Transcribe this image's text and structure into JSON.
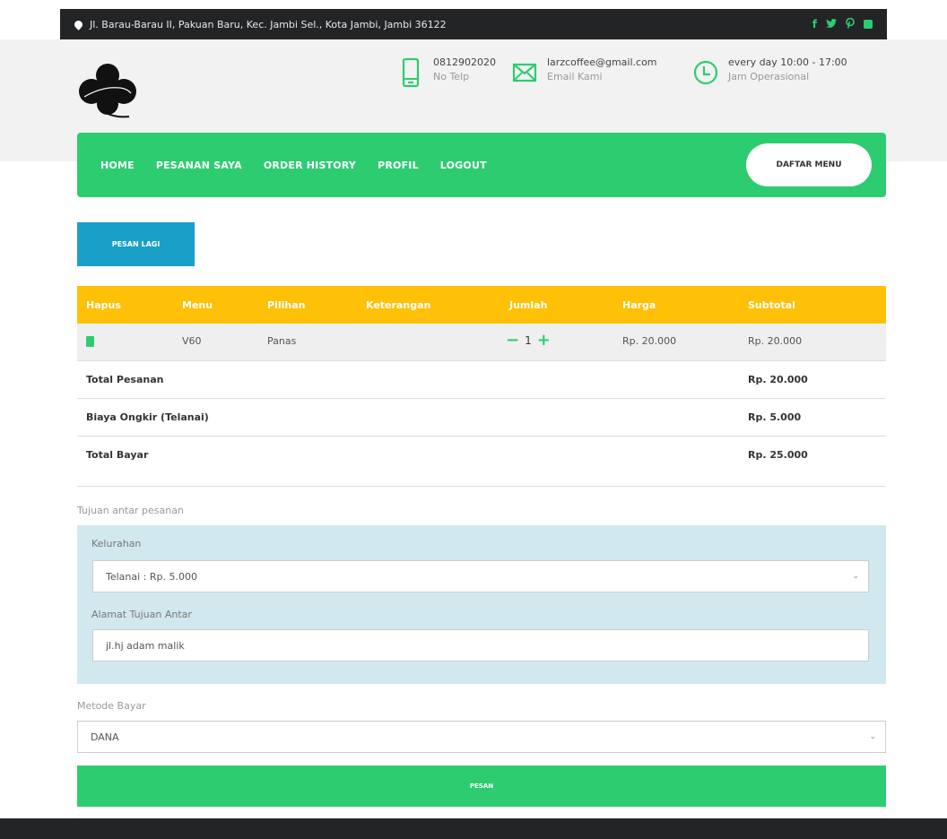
{
  "topbar": {
    "address": "Jl. Barau-Barau II, Pakuan Baru, Kec. Jambi Sel., Kota Jambi, Jambi 36122",
    "socials": [
      "facebook-icon",
      "twitter-icon",
      "pinterest-icon",
      "square-icon"
    ]
  },
  "contact": {
    "phone": "0812902020",
    "phone_label": "No Telp",
    "email": "larzcoffee@gmail.com",
    "email_label": "Email Kami",
    "hours": "every day 10:00 - 17:00",
    "hours_label": "Jam Operasional"
  },
  "nav": {
    "items": [
      "HOME",
      "PESANAN SAYA",
      "ORDER HISTORY",
      "PROFIL",
      "LOGOUT"
    ],
    "daftar": "DAFTAR MENU"
  },
  "order": {
    "pesan_lagi": "PESAN LAGI",
    "columns": [
      "Hapus",
      "Menu",
      "Pilihan",
      "Keterangan",
      "Jumlah",
      "Harga",
      "Subtotal"
    ],
    "row": {
      "menu": "V60",
      "pilihan": "Panas",
      "keterangan": "",
      "jumlah": "1",
      "harga": "Rp. 20.000",
      "subtotal": "Rp. 20.000"
    },
    "totals": [
      {
        "label": "Total Pesanan",
        "value": "Rp. 20.000"
      },
      {
        "label": "Biaya Ongkir (Telanai)",
        "value": "Rp. 5.000"
      },
      {
        "label": "Total Bayar",
        "value": "Rp. 25.000"
      }
    ]
  },
  "delivery": {
    "section_label": "Tujuan antar pesanan",
    "kelurahan_label": "Kelurahan",
    "kelurahan_value": "Telanai : Rp. 5.000",
    "alamat_label": "Alamat Tujuan Antar",
    "alamat_value": "jl.hj adam malik"
  },
  "payment": {
    "label": "Metode Bayar",
    "value": "DANA",
    "submit": "PESAN"
  },
  "colors": {
    "green": "#2ecc71",
    "yellow": "#ffc107",
    "blue": "#1aa0c6",
    "dark": "#222426"
  }
}
